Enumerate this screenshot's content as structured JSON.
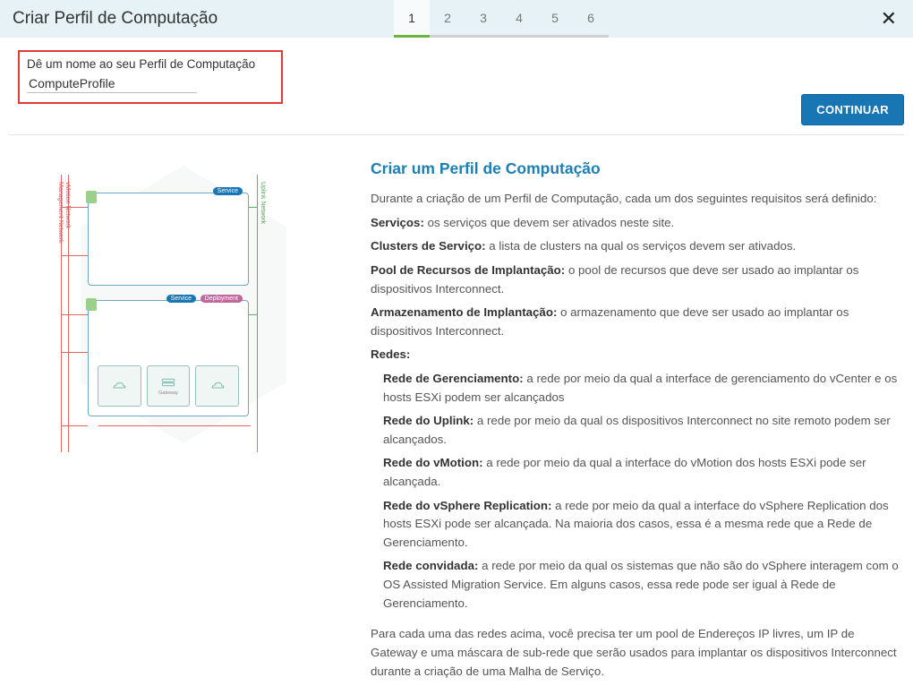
{
  "header": {
    "title": "Criar Perfil de Computação",
    "steps": [
      "1",
      "2",
      "3",
      "4",
      "5",
      "6"
    ],
    "active_step": 0
  },
  "form": {
    "name_label": "Dê um nome ao seu Perfil de Computação",
    "name_value": "ComputeProfile",
    "continue_label": "CONTINUAR"
  },
  "diagram": {
    "left_label_1": "Management Network",
    "left_label_2": "vMotion Network",
    "right_label_1": "Uplink Network",
    "badge_service": "Service",
    "badge_deployment": "Deployment",
    "mini_labels": [
      "",
      "Gateway",
      ""
    ]
  },
  "info": {
    "heading": "Criar um Perfil de Computação",
    "intro": "Durante a criação de um Perfil de Computação, cada um dos seguintes requisitos será definido:",
    "items": [
      {
        "k": "Serviços:",
        "v": " os serviços que devem ser ativados neste site."
      },
      {
        "k": "Clusters de Serviço:",
        "v": " a lista de clusters na qual os serviços devem ser ativados."
      },
      {
        "k": "Pool de Recursos de Implantação:",
        "v": " o pool de recursos que deve ser usado ao implantar os dispositivos Interconnect."
      },
      {
        "k": "Armazenamento de Implantação:",
        "v": " o armazenamento que deve ser usado ao implantar os dispositivos Interconnect."
      },
      {
        "k": "Redes:",
        "v": ""
      }
    ],
    "networks": [
      {
        "k": "Rede de Gerenciamento:",
        "v": " a rede por meio da qual a interface de gerenciamento do vCenter e os hosts ESXi podem ser alcançados"
      },
      {
        "k": "Rede do Uplink:",
        "v": " a rede por meio da qual os dispositivos Interconnect no site remoto podem ser alcançados."
      },
      {
        "k": "Rede do vMotion:",
        "v": " a rede por meio da qual a interface do vMotion dos hosts ESXi pode ser alcançada."
      },
      {
        "k": "Rede do vSphere Replication:",
        "v": " a rede por meio da qual a interface do vSphere Replication dos hosts ESXi pode ser alcançada. Na maioria dos casos, essa é a mesma rede que a Rede de Gerenciamento."
      },
      {
        "k": "Rede convidada:",
        "v": " a rede por meio da qual os sistemas que não são do vSphere interagem com o OS Assisted Migration Service. Em alguns casos, essa rede pode ser igual à Rede de Gerenciamento."
      }
    ],
    "footer": "Para cada uma das redes acima, você precisa ter um pool de Endereços IP livres, um IP de Gateway e uma máscara de sub-rede que serão usados para implantar os dispositivos Interconnect durante a criação de uma Malha de Serviço."
  }
}
